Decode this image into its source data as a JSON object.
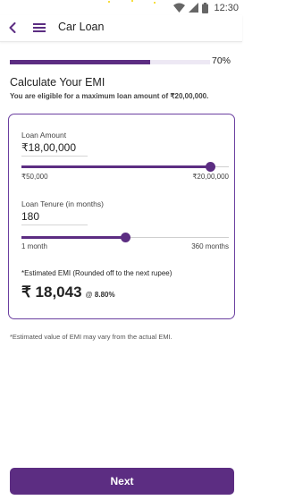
{
  "status_bar": {
    "time": "12:30",
    "icons": [
      "wifi-icon",
      "signal-icon",
      "battery-icon"
    ]
  },
  "app_bar": {
    "title": "Car Loan",
    "icons": [
      "back-icon",
      "menu-icon"
    ]
  },
  "progress": {
    "value": 0.7,
    "label": "70%"
  },
  "calculator": {
    "heading": "Calculate Your EMI",
    "eligibility_text": "You are eligible for a maximum loan amount of ₹20,00,000.",
    "loan_amount": {
      "label": "Loan Amount",
      "value": "₹18,00,000",
      "min_label": "₹50,000",
      "max_label": "₹20,00,000",
      "slider_fraction": 0.91
    },
    "loan_tenure": {
      "label": "Loan Tenure (in months)",
      "value": "180",
      "min_label": "1 month",
      "max_label": "360 months",
      "slider_fraction": 0.5
    },
    "emi": {
      "note": "*Estimated EMI (Rounded off to the next rupee)",
      "amount": "₹ 18,043",
      "rate_prefix": "@",
      "rate": "8.80%"
    }
  },
  "disclaimer": "*Estimated value of EMI may vary from the actual EMI.",
  "next_button": {
    "label": "Next"
  },
  "colors": {
    "accent": "#5c2d82",
    "track": "#ede8f4"
  }
}
